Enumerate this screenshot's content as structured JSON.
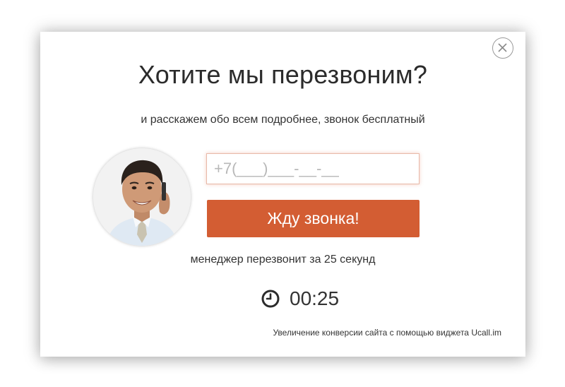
{
  "modal": {
    "title": "Хотите мы перезвоним?",
    "subtitle": "и расскажем обо всем подробнее, звонок бесплатный",
    "close_icon": "close-icon"
  },
  "form": {
    "phone_placeholder": "+7(___)___-__-__",
    "submit_label": "Жду звонка!"
  },
  "note": "менеджер перезвонит за 25 секунд",
  "timer": {
    "icon": "clock-icon",
    "value": "00:25"
  },
  "footer": "Увеличение конверсии сайта с помощью виджета Ucall.im",
  "colors": {
    "accent": "#d35d33",
    "text": "#333333"
  }
}
